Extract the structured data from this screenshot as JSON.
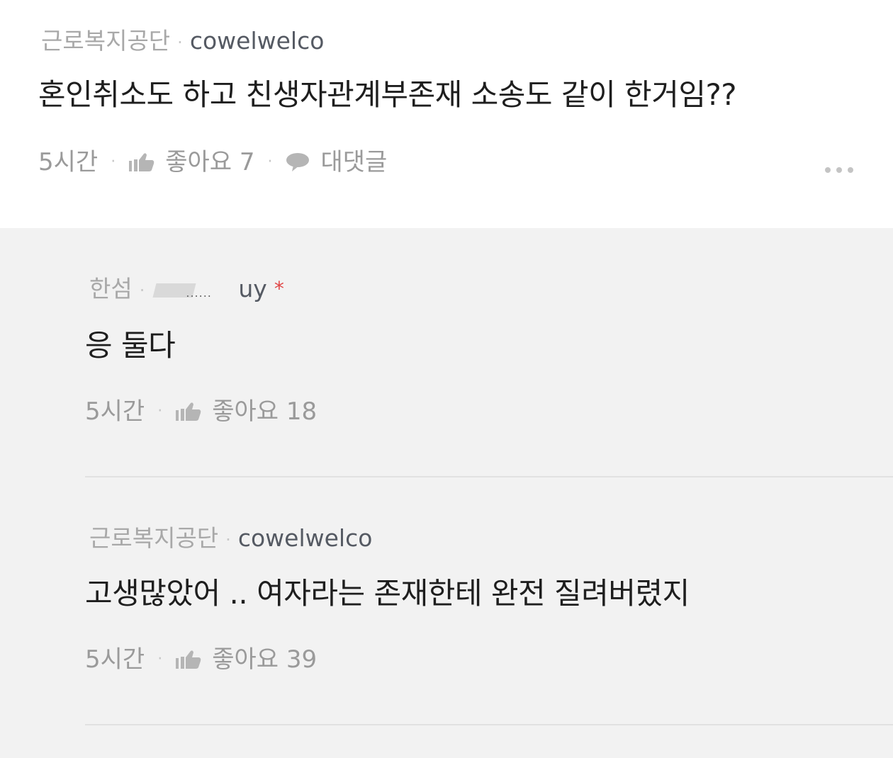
{
  "comments": [
    {
      "nickname": "근로복지공단",
      "user_id": "cowelwelco",
      "text": "혼인취소도 하고 친생자관계부존재 소송도 같이 한거임??",
      "time": "5시간",
      "like_label": "좋아요 7",
      "reply_label": "대댓글",
      "more_icon": "more-dots-icon"
    }
  ],
  "replies": [
    {
      "nickname": "한섬",
      "user_id_visible_tail": "uy",
      "author_mark": "*",
      "text": "응 둘다",
      "time": "5시간",
      "like_label": "좋아요 18"
    },
    {
      "nickname": "근로복지공단",
      "user_id": "cowelwelco",
      "text": "고생많았어 .. 여자라는 존재한테 완전 질려버렸지",
      "time": "5시간",
      "like_label": "좋아요 39"
    }
  ],
  "colors": {
    "reply_background": "#f2f2f2",
    "main_background": "#ffffff",
    "mark": "#e04646"
  }
}
